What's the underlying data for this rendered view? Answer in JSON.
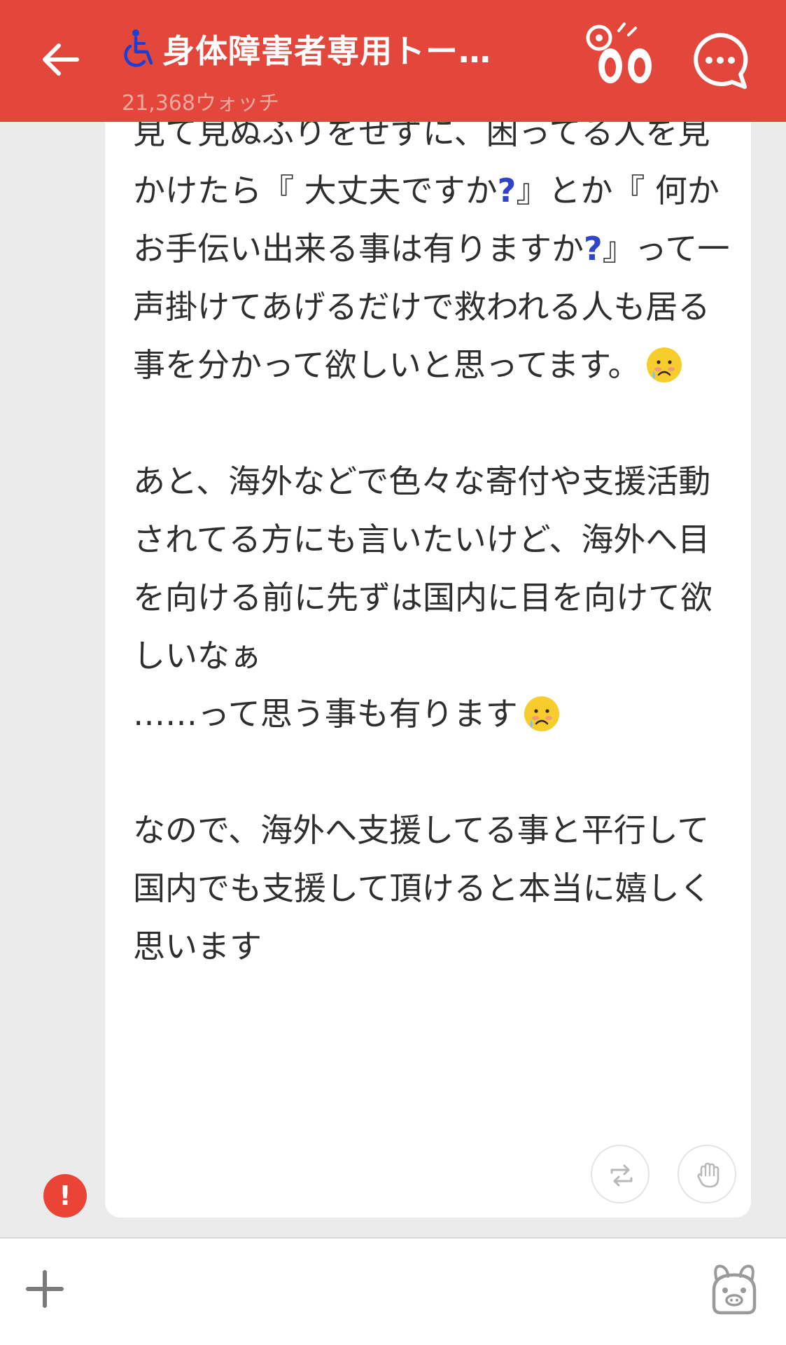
{
  "header": {
    "title": "身体障害者専用トー…",
    "watch_count": "21,368ウォッチ",
    "accent_color": "#e3473b",
    "icons": {
      "back": "arrow-left-icon",
      "title_prefix": "wheelchair-icon",
      "watch": "watch-eyes-icon",
      "chat": "chat-bubble-icon"
    }
  },
  "message": {
    "segments": [
      "見て見ぬふりをせずに、困ってる人を見かけたら『 大丈夫ですか",
      "?",
      "』とか『 何かお手伝い出来る事は有りますか",
      "?",
      "』って一声掛けてあげるだけで救われる人も居る事を分かって欲しいと思ってます。",
      "\n\nあと、海外などで色々な寄付や支援活動されてる方にも言いたいけど、海外へ目を向ける前に先ずは国内に目を向けて欲しいなぁ\n……って思う事も有ります",
      "\n\nなので、海外へ支援してる事と平行して国内でも支援して頂けると本当に嬉しく思います"
    ],
    "emoji": "sad-face-tear-icon"
  },
  "actions": {
    "repost_icon": "repost-icon",
    "clap_icon": "clap-hands-icon",
    "report_label": "!"
  },
  "bottom_bar": {
    "add_label": "+",
    "mascot_icon": "mascot-icon"
  }
}
